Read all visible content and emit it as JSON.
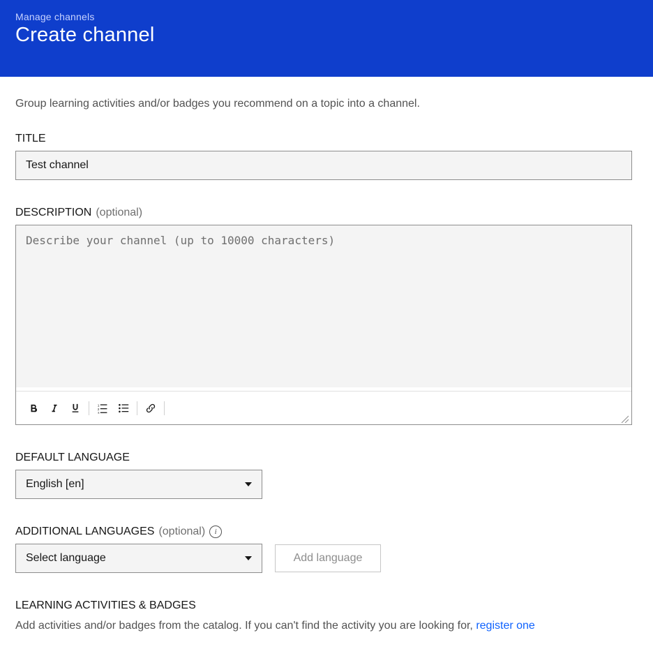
{
  "header": {
    "breadcrumb": "Manage channels",
    "title": "Create channel"
  },
  "intro": "Group learning activities and/or badges you recommend on a topic into a channel.",
  "title_field": {
    "label": "TITLE",
    "value": "Test channel"
  },
  "description_field": {
    "label": "DESCRIPTION",
    "optional": "(optional)",
    "placeholder": "Describe your channel (up to 10000 characters)"
  },
  "default_language": {
    "label": "DEFAULT LANGUAGE",
    "selected": "English [en]"
  },
  "additional_languages": {
    "label": "ADDITIONAL LANGUAGES",
    "optional": "(optional)",
    "selected": "Select language",
    "add_button": "Add language"
  },
  "activities": {
    "label": "LEARNING ACTIVITIES & BADGES",
    "text_prefix": "Add activities and/or badges from the catalog. If you can't find the activity you are looking for, ",
    "link_text": "register one"
  }
}
